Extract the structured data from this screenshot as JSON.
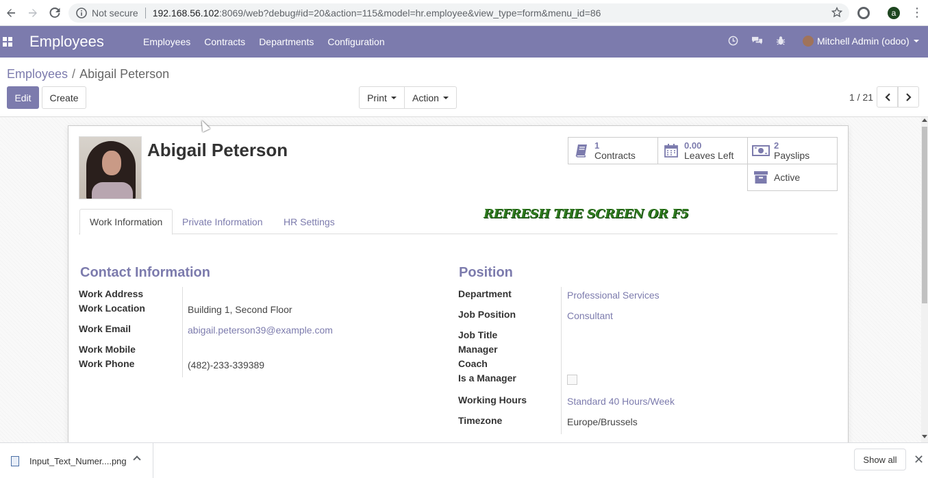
{
  "browser": {
    "not_secure": "Not secure",
    "url_host": "192.168.56.102",
    "url_rest": ":8069/web?debug#id=20&action=115&model=hr.employee&view_type=form&menu_id=86",
    "profile_initial": "a"
  },
  "navbar": {
    "brand": "Employees",
    "menu": [
      "Employees",
      "Contracts",
      "Departments",
      "Configuration"
    ],
    "user": "Mitchell Admin (odoo)"
  },
  "control_panel": {
    "breadcrumb_root": "Employees",
    "breadcrumb_current": "Abigail Peterson",
    "edit_label": "Edit",
    "create_label": "Create",
    "print_label": "Print",
    "action_label": "Action",
    "pager": "1 / 21"
  },
  "employee": {
    "name": "Abigail Peterson"
  },
  "smart_buttons": {
    "contracts_value": "1",
    "contracts_label": "Contracts",
    "leaves_value": "0.00",
    "leaves_label": "Leaves Left",
    "payslips_value": "2",
    "payslips_label": "Payslips",
    "active_label": "Active"
  },
  "tabs": [
    "Work Information",
    "Private Information",
    "HR Settings"
  ],
  "overlay_note": "REFRESH THE SCREEN OR F5",
  "contact": {
    "title": "Contact Information",
    "work_address_label": "Work Address",
    "work_location_label": "Work Location",
    "work_location": "Building 1, Second Floor",
    "work_email_label": "Work Email",
    "work_email": "abigail.peterson39@example.com",
    "work_mobile_label": "Work Mobile",
    "work_phone_label": "Work Phone",
    "work_phone": "(482)-233-339389"
  },
  "position": {
    "title": "Position",
    "department_label": "Department",
    "department": "Professional Services",
    "job_position_label": "Job Position",
    "job_position": "Consultant",
    "job_title_label": "Job Title",
    "manager_label": "Manager",
    "coach_label": "Coach",
    "is_manager_label": "Is a Manager",
    "working_hours_label": "Working Hours",
    "working_hours": "Standard 40 Hours/Week",
    "timezone_label": "Timezone",
    "timezone": "Europe/Brussels"
  },
  "download_bar": {
    "file_name": "Input_Text_Numer....png",
    "show_all": "Show all"
  },
  "colors": {
    "odoo_primary": "#7c7bad",
    "refresh_note": "#2f7a1f"
  }
}
